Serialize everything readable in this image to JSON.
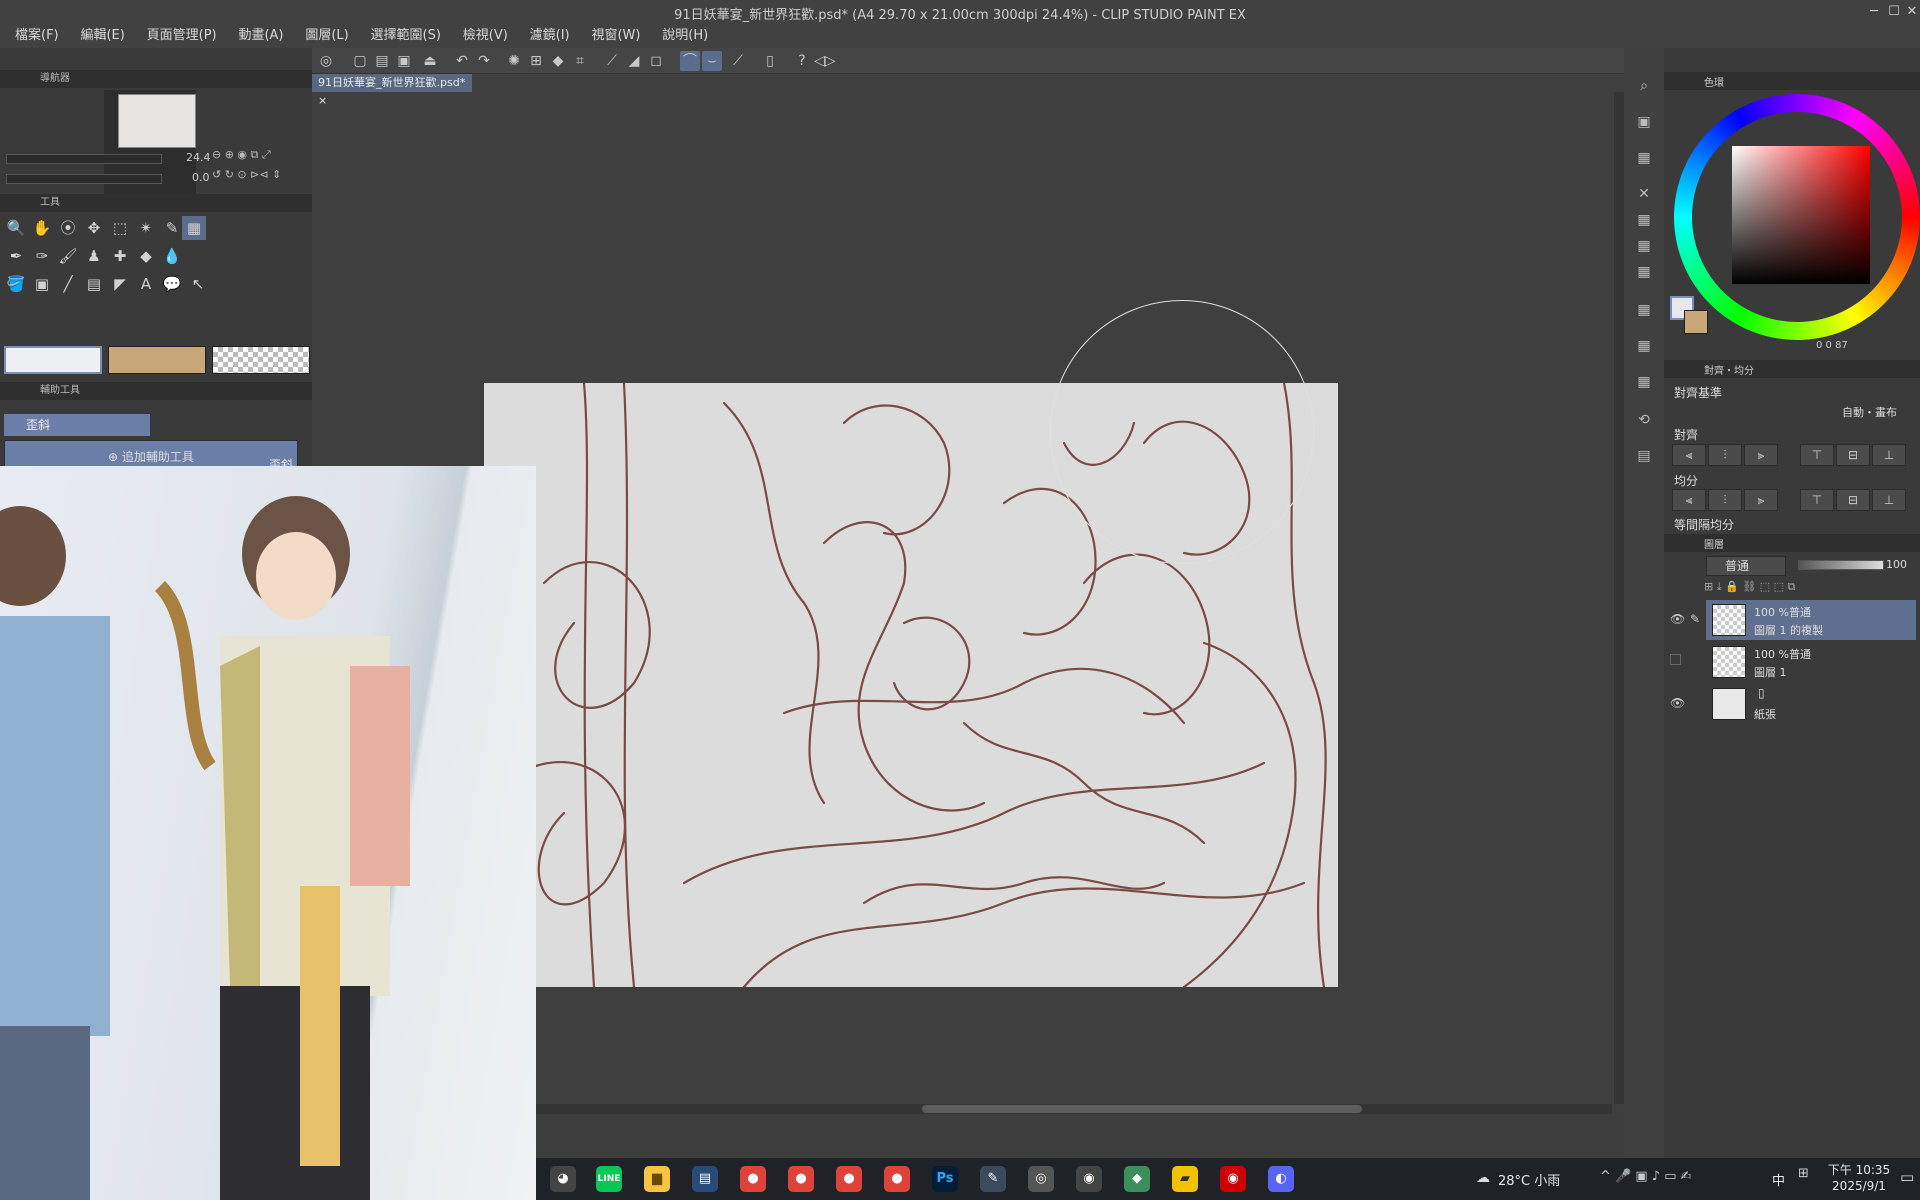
{
  "window": {
    "title": "91日妖華宴_新世界狂歡.psd* (A4 29.70 x 21.00cm 300dpi 24.4%)  - CLIP STUDIO PAINT EX",
    "minimize": "─",
    "maximize": "☐",
    "close": "✕"
  },
  "menu": [
    "檔案(F)",
    "編輯(E)",
    "頁面管理(P)",
    "動畫(A)",
    "圖層(L)",
    "選擇範圍(S)",
    "檢視(V)",
    "濾鏡(I)",
    "視窗(W)",
    "說明(H)"
  ],
  "navigator": {
    "title": "導航器",
    "zoom_value": "24.4",
    "rotate_value": "0.0"
  },
  "tools": {
    "title": "工具",
    "row1": [
      "🔍",
      "✋",
      "⦿",
      "✥",
      "⬚",
      "✴",
      "✎",
      "▦"
    ],
    "row2": [
      "✒",
      "✑",
      "🖌",
      "♟",
      "✚",
      "◆",
      "💧"
    ],
    "row3": [
      "🪣",
      "▣",
      "╱",
      "▤",
      "◤",
      "A",
      "💬",
      "↖"
    ]
  },
  "subtools": {
    "title": "輔助工具",
    "group_tab": "歪斜",
    "item_label": "歪斜",
    "add_button": "追加輔助工具"
  },
  "document": {
    "tab_label": "91日妖華宴_新世界狂歡.psd*",
    "tab_close": "×"
  },
  "color_panel": {
    "tab": "色環",
    "values": "0  0  87",
    "accent_hue_colors": [
      "#ff0000",
      "#ffff00",
      "#00ff00",
      "#00ffff",
      "#0000ff",
      "#ff00ff"
    ],
    "main_color": "#e8e8ec",
    "sub_color": "#c8a878"
  },
  "align_panel": {
    "tab": "對齊・均分",
    "basis_label": "對齊基準",
    "basis_value": "自動・畫布",
    "align_label": "對齊",
    "distribute_label": "均分",
    "equal_spacing_label": "等間隔均分"
  },
  "layers": {
    "tab": "圖層",
    "blend_mode": "普通",
    "opacity": "100",
    "items": [
      {
        "mode": "100 %普通",
        "name": "圖層 1 的複製",
        "visible": true,
        "selected": true
      },
      {
        "mode": "100 %普通",
        "name": "圖層 1",
        "visible": false,
        "selected": false
      },
      {
        "mode": "",
        "name": "紙張",
        "visible": true,
        "selected": false
      }
    ]
  },
  "taskbar": {
    "weather": "28°C  小雨",
    "ime": "中",
    "time": "下午 10:35",
    "date": "2025/9/1",
    "apps": [
      {
        "icon": "line-icon",
        "label": "LINE",
        "color": "#06c755"
      },
      {
        "icon": "folder-icon",
        "label": "▆",
        "color": "#f5c542"
      },
      {
        "icon": "chrome-icon",
        "label": "●",
        "color": "#db4437"
      },
      {
        "icon": "chrome-icon",
        "label": "●",
        "color": "#db4437"
      },
      {
        "icon": "chrome-icon",
        "label": "●",
        "color": "#db4437"
      },
      {
        "icon": "chrome-icon",
        "label": "●",
        "color": "#db4437"
      },
      {
        "icon": "photoshop-icon",
        "label": "Ps",
        "color": "#001e36"
      },
      {
        "icon": "clip-studio-icon",
        "label": "✎",
        "color": "#3b4a5c"
      },
      {
        "icon": "app-icon",
        "label": "◎",
        "color": "#555"
      },
      {
        "icon": "app-icon",
        "label": "◉",
        "color": "#444"
      },
      {
        "icon": "app-icon",
        "label": "◆",
        "color": "#3a8f5a"
      },
      {
        "icon": "sticky-notes-icon",
        "label": "▰",
        "color": "#f2c200"
      },
      {
        "icon": "app-icon",
        "label": "◉",
        "color": "#c00"
      },
      {
        "icon": "discord-icon",
        "label": "◐",
        "color": "#5865f2"
      }
    ]
  }
}
